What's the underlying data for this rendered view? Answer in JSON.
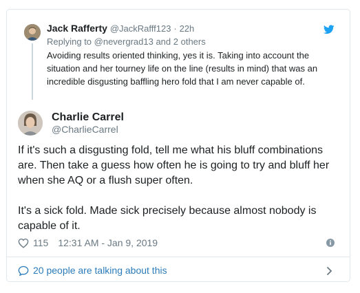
{
  "reply_tweet": {
    "name": "Jack Rafferty",
    "handle": "@JackRafff123",
    "separator": "·",
    "time": "22h",
    "replying_to": "Replying to @nevergrad13 and 2 others",
    "text": "Avoiding results oriented thinking, yes it is. Taking into account the situation and her tourney life on the line (results in mind) that was an incredible disgusting baffling hero fold that I am never capable of."
  },
  "main_tweet": {
    "name": "Charlie Carrel",
    "handle": "@CharlieCarrel",
    "paragraph_1": "If it's such a disgusting fold, tell me what his bluff combinations are. Then take a guess how often he is going to try and bluff her when she AQ or a flush super often.",
    "paragraph_2": "It's a sick fold. Made sick precisely because almost nobody is capable of it.",
    "likes": "115",
    "timestamp": "12:31 AM - Jan 9, 2019"
  },
  "footer": {
    "talking_label": "20 people are talking about this"
  },
  "colors": {
    "twitter_blue": "#1da1f2",
    "link_blue": "#2b7bb9",
    "muted": "#697882",
    "border": "#e1e8ed"
  },
  "icons": [
    "twitter-bird-icon",
    "heart-icon",
    "info-icon",
    "speech-bubble-icon",
    "chevron-right-icon"
  ]
}
